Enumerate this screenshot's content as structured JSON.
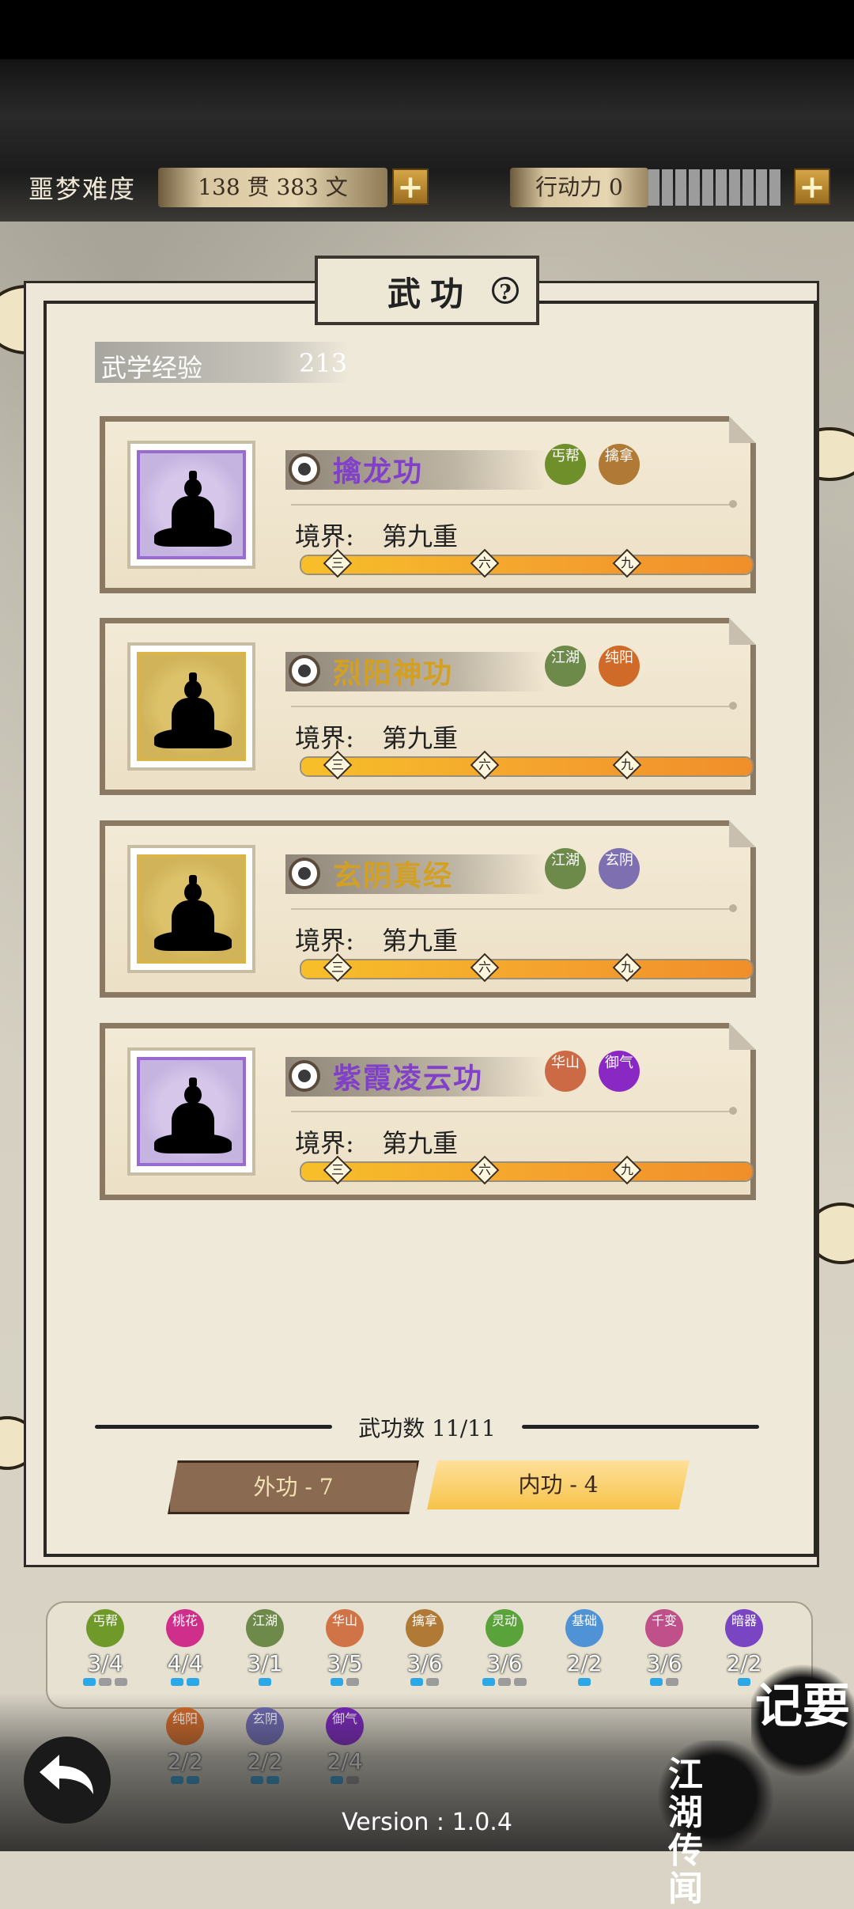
{
  "header": {
    "difficulty": "噩梦难度",
    "money": "138 贯 383 文",
    "action_label": "行动力 0",
    "action_slots": 10
  },
  "title": {
    "text": "武功"
  },
  "experience": {
    "label": "武学经验",
    "value": "213"
  },
  "realm_label": "境界:",
  "skills": [
    {
      "name": "擒龙功",
      "tier": "purple",
      "realm": "第九重",
      "progress": 1.0,
      "tags": [
        {
          "text": "丐帮",
          "color": "#6f8f2a"
        },
        {
          "text": "擒拿",
          "color": "#b07a36"
        }
      ]
    },
    {
      "name": "烈阳神功",
      "tier": "gold",
      "realm": "第九重",
      "progress": 1.0,
      "tags": [
        {
          "text": "江湖",
          "color": "#6d8a4b"
        },
        {
          "text": "纯阳",
          "color": "#cf6a28"
        }
      ]
    },
    {
      "name": "玄阴真经",
      "tier": "gold",
      "realm": "第九重",
      "progress": 1.0,
      "tags": [
        {
          "text": "江湖",
          "color": "#6d8a4b"
        },
        {
          "text": "玄阴",
          "color": "#7e6fb0"
        }
      ]
    },
    {
      "name": "紫霞凌云功",
      "tier": "purple",
      "realm": "第九重",
      "progress": 1.0,
      "tags": [
        {
          "text": "华山",
          "color": "#cc6a45"
        },
        {
          "text": "御气",
          "color": "#8a28c4"
        }
      ]
    }
  ],
  "progress_markers": [
    "三",
    "六",
    "九"
  ],
  "skill_count": "武功数 11/11",
  "tabs": {
    "outer": "外功 - 7",
    "inner": "内功 - 4"
  },
  "sects": [
    {
      "name": "丐帮",
      "count": "3/4",
      "color": "#6f9a2a",
      "pips": [
        1,
        0,
        0
      ]
    },
    {
      "name": "桃花",
      "count": "4/4",
      "color": "#cf2f8a",
      "pips": [
        1,
        1
      ]
    },
    {
      "name": "江湖",
      "count": "3/1",
      "color": "#6d8a4b",
      "pips": [
        1
      ]
    },
    {
      "name": "华山",
      "count": "3/5",
      "color": "#d07447",
      "pips": [
        1,
        0
      ]
    },
    {
      "name": "擒拿",
      "count": "3/6",
      "color": "#b07a36",
      "pips": [
        1,
        0
      ]
    },
    {
      "name": "灵动",
      "count": "3/6",
      "color": "#5aa33a",
      "pips": [
        1,
        0,
        0
      ]
    },
    {
      "name": "基础",
      "count": "2/2",
      "color": "#4f93d6",
      "pips": [
        1
      ]
    },
    {
      "name": "千变",
      "count": "3/6",
      "color": "#c0508a",
      "pips": [
        1,
        0
      ]
    },
    {
      "name": "暗器",
      "count": "2/2",
      "color": "#7a45c2",
      "pips": [
        1
      ]
    },
    {
      "name": "纯阳",
      "count": "2/2",
      "color": "#d86a25",
      "pips": [
        1,
        1
      ]
    },
    {
      "name": "玄阴",
      "count": "2/2",
      "color": "#6e6ab6",
      "pips": [
        1,
        1
      ]
    },
    {
      "name": "御气",
      "count": "2/4",
      "color": "#7b22c0",
      "pips": [
        1,
        0
      ]
    }
  ],
  "corner_buttons": {
    "notes": "记要",
    "rumors": "江湖传闻"
  },
  "version": "Version : 1.0.4"
}
